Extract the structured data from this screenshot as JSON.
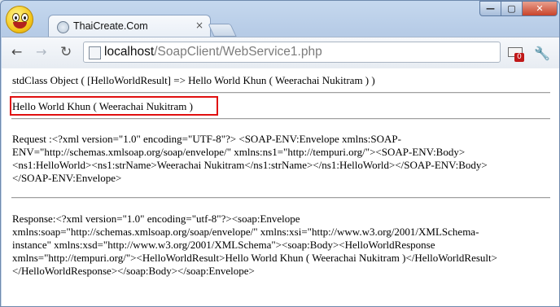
{
  "browser": {
    "tab_title": "ThaiCreate.Com",
    "tab_close": "×",
    "window_controls": {
      "minimize": "—",
      "maximize": "▢",
      "close": "✕"
    },
    "nav": {
      "back": "←",
      "forward": "→",
      "reload": "↻"
    },
    "address": {
      "host": "localhost",
      "path": "/SoapClient/WebService1.php"
    },
    "extension_badge_count": "0",
    "menu_icon": "wrench-icon"
  },
  "page": {
    "result_object": "stdClass Object ( [HelloWorldResult] => Hello World Khun ( Weerachai Nukitram ) )",
    "hello_line": "Hello World Khun ( Weerachai Nukitram )",
    "request_lines": [
      "Request :<?xml version=\"1.0\" encoding=\"UTF-8\"?> <SOAP-ENV:Envelope xmlns:SOAP-",
      "ENV=\"http://schemas.xmlsoap.org/soap/envelope/\" xmlns:ns1=\"http://tempuri.org/\"><SOAP-ENV:Body>",
      "<ns1:HelloWorld><ns1:strName>Weerachai Nukitram</ns1:strName></ns1:HelloWorld></SOAP-ENV:Body>",
      "</SOAP-ENV:Envelope>"
    ],
    "response_lines": [
      "Response:<?xml version=\"1.0\" encoding=\"utf-8\"?><soap:Envelope",
      "xmlns:soap=\"http://schemas.xmlsoap.org/soap/envelope/\" xmlns:xsi=\"http://www.w3.org/2001/XMLSchema-",
      "instance\" xmlns:xsd=\"http://www.w3.org/2001/XMLSchema\"><soap:Body><HelloWorldResponse",
      "xmlns=\"http://tempuri.org/\"><HelloWorldResult>Hello World Khun ( Weerachai Nukitram )</HelloWorldResult>",
      "</HelloWorldResponse></soap:Body></soap:Envelope>"
    ],
    "highlight_color": "#e01010"
  }
}
